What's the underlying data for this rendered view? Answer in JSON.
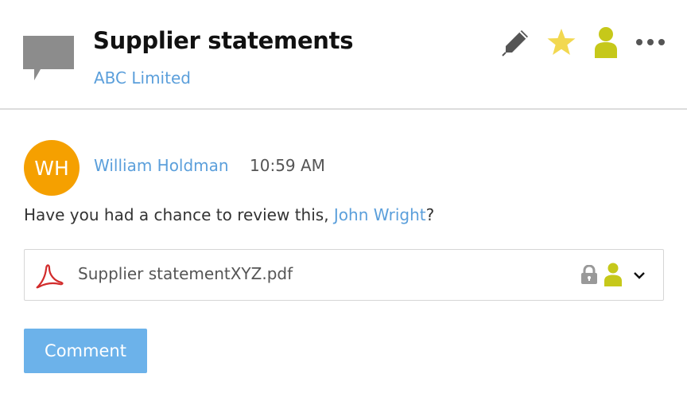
{
  "header": {
    "title": "Supplier statements",
    "subtitle": "ABC Limited",
    "icons": [
      "chat-bubble-icon",
      "pencil-icon",
      "star-icon",
      "user-icon",
      "more-icon"
    ]
  },
  "post": {
    "avatar_initials": "WH",
    "author": "William Holdman",
    "time": "10:59 AM",
    "message_before": "Have you had a chance to review this, ",
    "mention": "John Wright",
    "message_after": "?"
  },
  "attachment": {
    "file_name": "Supplier statementXYZ.pdf",
    "icons": [
      "pdf-icon",
      "lock-icon",
      "user-icon",
      "chevron-down-icon"
    ]
  },
  "actions": {
    "comment_label": "Comment"
  },
  "colors": {
    "link": "#5b9fdb",
    "avatar": "#f5a000",
    "star": "#f2d850",
    "user_icon": "#c6c81a",
    "button": "#6cb2ea",
    "pdf": "#d22b2b"
  }
}
